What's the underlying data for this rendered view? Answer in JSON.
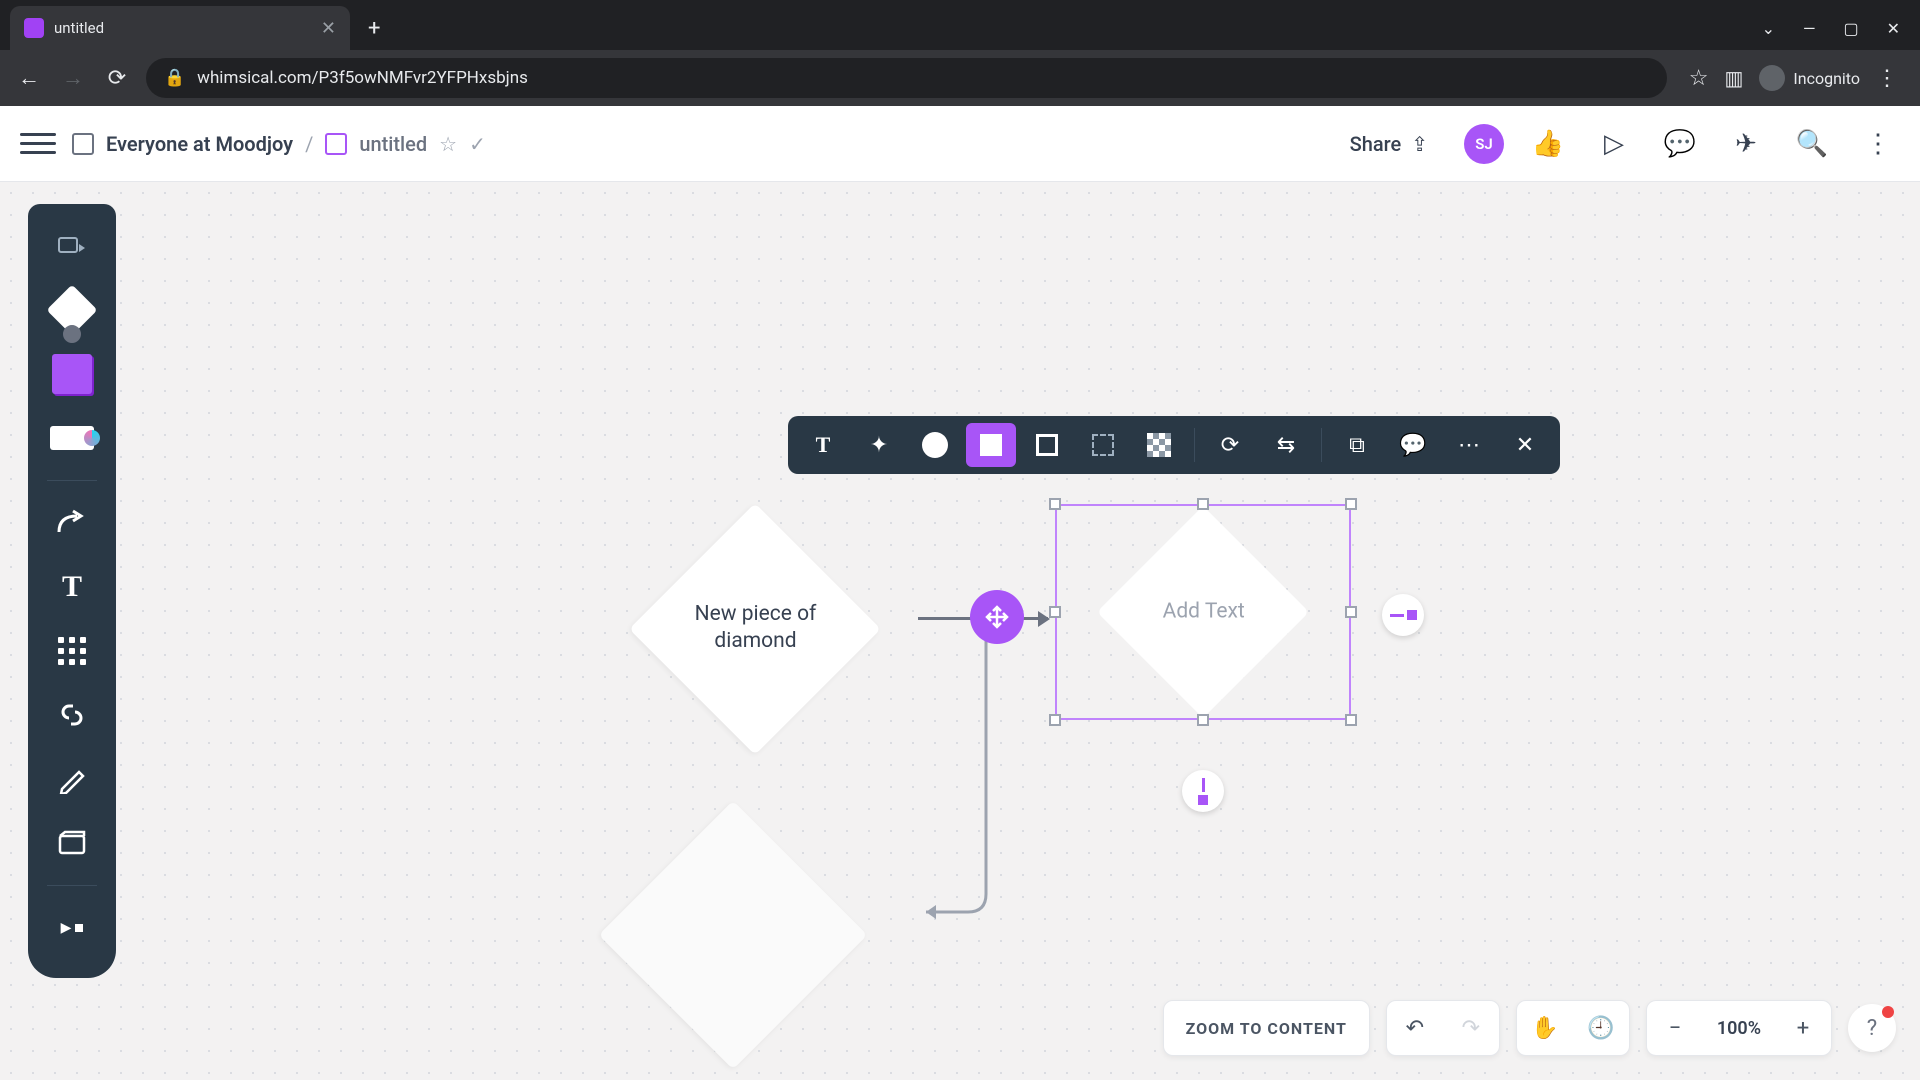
{
  "browser": {
    "tab_title": "untitled",
    "url": "whimsical.com/P3f5owNMFvr2YFPHxsbjns",
    "incognito_label": "Incognito"
  },
  "header": {
    "workspace": "Everyone at Moodjoy",
    "doc_title": "untitled",
    "share_label": "Share",
    "avatar_initials": "SJ"
  },
  "left_toolbar": {
    "items": [
      "select-tool",
      "shape-tool",
      "sticky-note-tool",
      "card-tool",
      "connector-tool",
      "text-tool",
      "grid-tool",
      "link-tool",
      "pencil-tool",
      "frame-tool",
      "more-tools"
    ]
  },
  "context_toolbar": {
    "items": [
      "text-style",
      "swap-shape",
      "fill-color",
      "fill-solid",
      "border-outline",
      "border-corner",
      "pattern-fill",
      "rotate",
      "swap-direction",
      "duplicate",
      "comment",
      "more",
      "close"
    ]
  },
  "shapes": {
    "diamond1_text": "New piece of diamond",
    "selected_placeholder": "Add Text"
  },
  "bottom": {
    "zoom_to_content": "ZOOM TO CONTENT",
    "zoom_value": "100%"
  }
}
